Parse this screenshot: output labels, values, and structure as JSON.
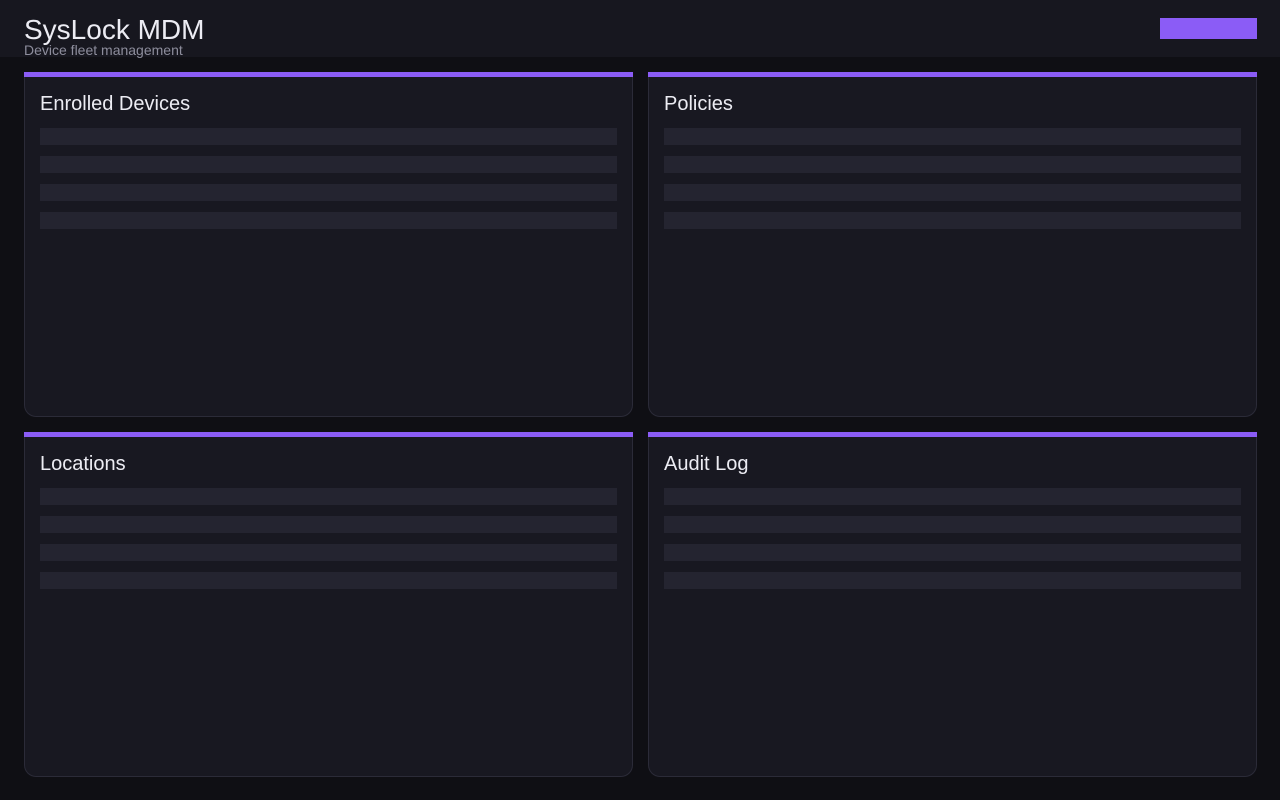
{
  "header": {
    "title": "SysLock MDM",
    "subtitle": "Device fleet management",
    "action_button_label": ""
  },
  "panels": [
    {
      "title": "Enrolled Devices"
    },
    {
      "title": "Policies"
    },
    {
      "title": "Locations"
    },
    {
      "title": "Audit Log"
    }
  ],
  "colors": {
    "accent": "#8b5cf6",
    "background": "#0f0f14",
    "panel": "#181821",
    "header": "#17171f",
    "placeholder_row": "#242430"
  }
}
